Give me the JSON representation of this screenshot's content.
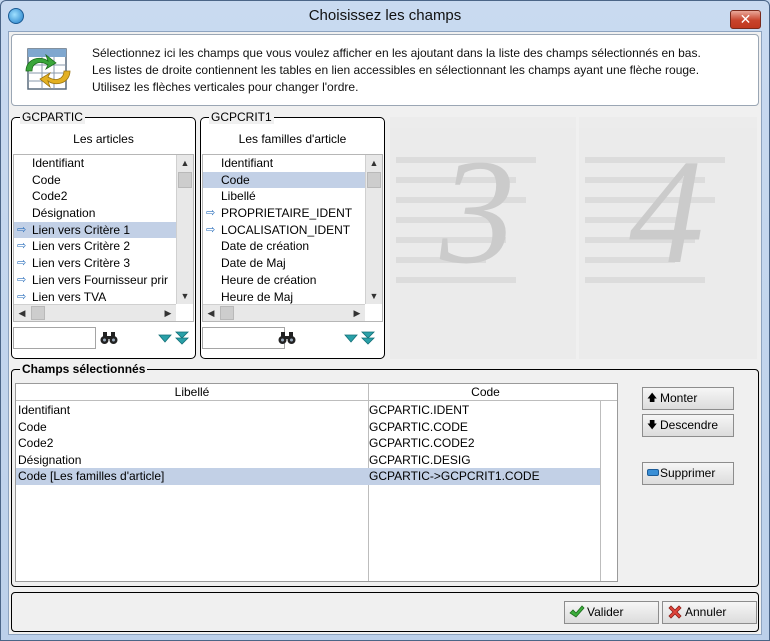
{
  "window": {
    "title": "Choisissez les champs"
  },
  "info": {
    "lines": [
      "Sélectionnez ici les champs que vous voulez afficher en les ajoutant dans la liste des champs sélectionnés en bas.",
      "Les listes de droite contiennent les tables en lien accessibles en sélectionnant les champs ayant une flèche rouge.",
      "Utilisez les flèches verticales pour changer l'ordre."
    ]
  },
  "panel1": {
    "code": "GCPARTIC",
    "title": "Les articles",
    "items": [
      {
        "label": "Identifiant",
        "link": false,
        "selected": false
      },
      {
        "label": "Code",
        "link": false,
        "selected": false
      },
      {
        "label": "Code2",
        "link": false,
        "selected": false
      },
      {
        "label": "Désignation",
        "link": false,
        "selected": false
      },
      {
        "label": "Lien vers Critère 1",
        "link": true,
        "selected": true
      },
      {
        "label": "Lien vers Critère 2",
        "link": true,
        "selected": false
      },
      {
        "label": "Lien vers Critère 3",
        "link": true,
        "selected": false
      },
      {
        "label": "Lien vers Fournisseur prir",
        "link": true,
        "selected": false
      },
      {
        "label": "Lien vers TVA",
        "link": true,
        "selected": false
      }
    ],
    "search_value": ""
  },
  "panel2": {
    "code": "GCPCRIT1",
    "title": "Les familles d'article",
    "items": [
      {
        "label": "Identifiant",
        "link": false,
        "selected": false
      },
      {
        "label": "Code",
        "link": false,
        "selected": true
      },
      {
        "label": "Libellé",
        "link": false,
        "selected": false
      },
      {
        "label": "PROPRIETAIRE_IDENT",
        "link": true,
        "selected": false
      },
      {
        "label": "LOCALISATION_IDENT",
        "link": true,
        "selected": false
      },
      {
        "label": "Date de création",
        "link": false,
        "selected": false
      },
      {
        "label": "Date de Maj",
        "link": false,
        "selected": false
      },
      {
        "label": "Heure de création",
        "link": false,
        "selected": false
      },
      {
        "label": "Heure de Maj",
        "link": false,
        "selected": false
      }
    ],
    "search_value": ""
  },
  "ghost_panels": {
    "third": "3",
    "fourth": "4"
  },
  "selected": {
    "legend": "Champs sélectionnés",
    "columns": [
      "Libellé",
      "Code"
    ],
    "rows": [
      {
        "label": "Identifiant",
        "code": "GCPARTIC.IDENT",
        "selected": false
      },
      {
        "label": "Code",
        "code": "GCPARTIC.CODE",
        "selected": false
      },
      {
        "label": "Code2",
        "code": "GCPARTIC.CODE2",
        "selected": false
      },
      {
        "label": "Désignation",
        "code": "GCPARTIC.DESIG",
        "selected": false
      },
      {
        "label": "Code [Les familles d'article]",
        "code": "GCPARTIC->GCPCRIT1.CODE",
        "selected": true
      }
    ]
  },
  "buttons": {
    "up": "Monter",
    "down": "Descendre",
    "delete": "Supprimer",
    "ok": "Valider",
    "cancel": "Annuler"
  },
  "colors": {
    "selection": "#c2d0e6",
    "link_arrow": "#2a6ebb",
    "ok_check": "#2e9b2e",
    "cancel_x": "#d0342c"
  }
}
